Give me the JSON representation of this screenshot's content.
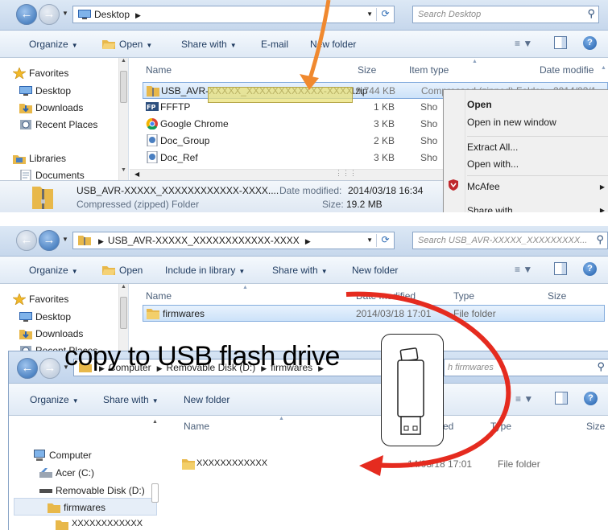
{
  "panel1": {
    "address": {
      "crumbs": [
        "Desktop"
      ]
    },
    "search_placeholder": "Search Desktop",
    "toolbar": {
      "organize": "Organize",
      "open": "Open",
      "share": "Share with",
      "email": "E-mail",
      "new_folder": "New folder"
    },
    "nav": {
      "favorites": "Favorites",
      "desktop": "Desktop",
      "downloads": "Downloads",
      "recent": "Recent Places",
      "libraries": "Libraries",
      "documents": "Documents"
    },
    "columns": {
      "name": "Name",
      "size": "Size",
      "type": "Item type",
      "date": "Date modifie"
    },
    "files": [
      {
        "name": "USB_AVR-XXXXX_XXXXXXXXXXXX-XXXX.zip",
        "size": "19,744 KB",
        "type": "Compressed (zipped) Folder",
        "date": "2014/03/1",
        "icon": "zip-icon"
      },
      {
        "name": "FFFTP",
        "size": "1 KB",
        "type": "Sho",
        "icon": "ffftp-icon"
      },
      {
        "name": "Google Chrome",
        "size": "3 KB",
        "type": "Sho",
        "icon": "chrome-icon"
      },
      {
        "name": "Doc_Group",
        "size": "2 KB",
        "type": "Sho",
        "icon": "doc-icon"
      },
      {
        "name": "Doc_Ref",
        "size": "3 KB",
        "type": "Sho",
        "icon": "doc-icon"
      }
    ],
    "status": {
      "name": "USB_AVR-XXXXX_XXXXXXXXXXXX-XXXX....",
      "date_label": "Date modified:",
      "date": "2014/03/18 16:34",
      "type": "Compressed (zipped) Folder",
      "size_label": "Size:",
      "size": "19.2 MB"
    },
    "context_menu": [
      "Open",
      "Open in new window",
      "Extract All...",
      "Open with...",
      "McAfee",
      "Share with"
    ]
  },
  "panel2": {
    "address": {
      "crumbs": [
        "USB_AVR-XXXXX_XXXXXXXXXXXX-XXXX"
      ]
    },
    "search_placeholder": "Search USB_AVR-XXXXX_XXXXXXXXX...",
    "toolbar": {
      "organize": "Organize",
      "open": "Open",
      "include": "Include in library",
      "share": "Share with",
      "new_folder": "New folder"
    },
    "nav": {
      "favorites": "Favorites",
      "desktop": "Desktop",
      "downloads": "Downloads",
      "recent": "Recent Places"
    },
    "columns": {
      "name": "Name",
      "date": "Date modified",
      "type": "Type",
      "size": "Size"
    },
    "files": [
      {
        "name": "firmwares",
        "date": "2014/03/18 17:01",
        "type": "File folder"
      }
    ]
  },
  "panel3": {
    "address": {
      "crumbs": [
        "Computer",
        "Removable Disk (D:)",
        "firmwares"
      ]
    },
    "search_placeholder": "h firmwares",
    "toolbar": {
      "organize": "Organize",
      "share": "Share with",
      "new_folder": "New folder"
    },
    "nav": {
      "computer": "Computer",
      "acer": "Acer (C:)",
      "removable": "Removable Disk (D:)",
      "firmwares": "firmwares",
      "sub": "XXXXXXXXXXXX"
    },
    "columns": {
      "name": "Name",
      "date": "ed",
      "type": "Type",
      "size": "Size"
    },
    "files": [
      {
        "name": "XXXXXXXXXXXX",
        "date": "14/03/18 17:01",
        "type": "File folder"
      }
    ]
  },
  "annotation": {
    "caption": "copy to USB flash drive"
  },
  "colors": {
    "orange_arrow": "#f0892f",
    "red_arrow": "#e52b1f",
    "selection": "#cce2f9"
  }
}
